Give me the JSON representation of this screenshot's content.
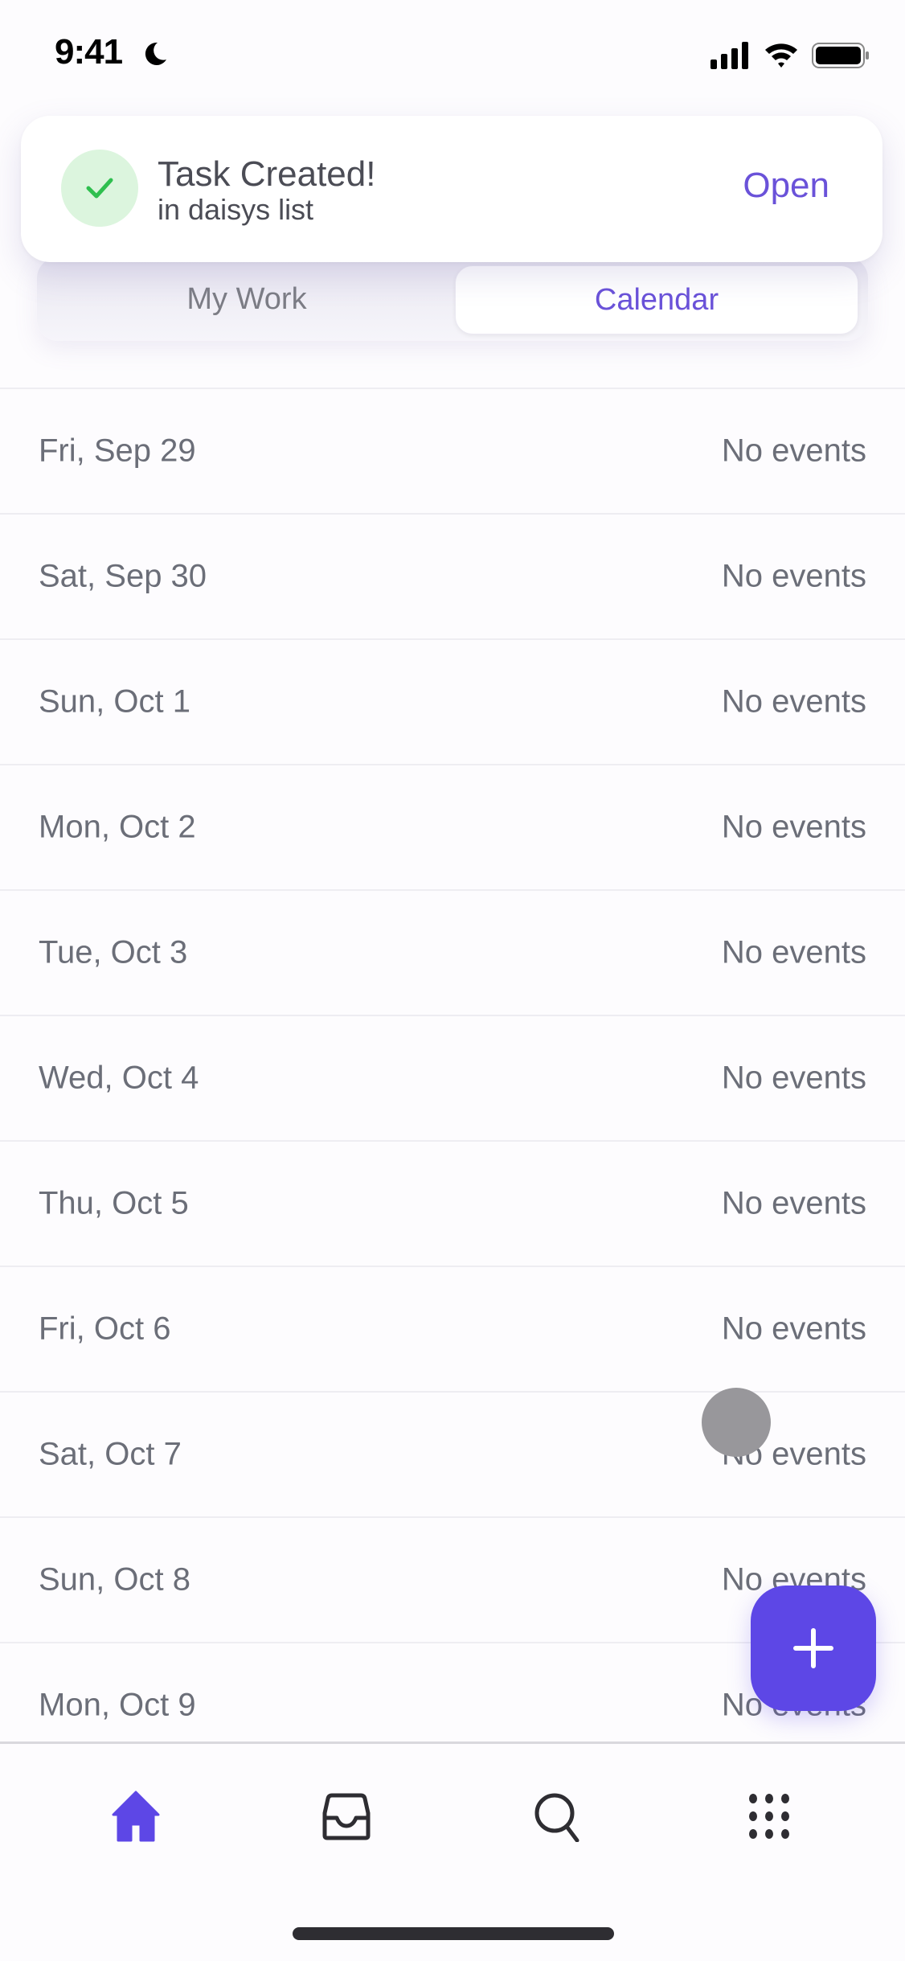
{
  "status_bar": {
    "time": "9:41",
    "focus_icon": "moon-icon",
    "signal_icon": "cellular-signal-icon",
    "wifi_icon": "wifi-icon",
    "battery_icon": "battery-icon"
  },
  "toast": {
    "icon": "checkmark-icon",
    "title": "Task Created!",
    "subtitle": "in daisys list",
    "action_label": "Open"
  },
  "segmented_control": {
    "tabs": [
      {
        "label": "My Work",
        "selected": false
      },
      {
        "label": "Calendar",
        "selected": true
      }
    ]
  },
  "calendar": {
    "days": [
      {
        "date": "Fri, Sep 29",
        "status": "No events"
      },
      {
        "date": "Sat, Sep 30",
        "status": "No events"
      },
      {
        "date": "Sun, Oct 1",
        "status": "No events"
      },
      {
        "date": "Mon, Oct 2",
        "status": "No events"
      },
      {
        "date": "Tue, Oct 3",
        "status": "No events"
      },
      {
        "date": "Wed, Oct 4",
        "status": "No events"
      },
      {
        "date": "Thu, Oct 5",
        "status": "No events"
      },
      {
        "date": "Fri, Oct 6",
        "status": "No events"
      },
      {
        "date": "Sat, Oct 7",
        "status": "No events"
      },
      {
        "date": "Sun, Oct 8",
        "status": "No events"
      },
      {
        "date": "Mon, Oct 9",
        "status": "No events"
      }
    ]
  },
  "fab": {
    "icon": "plus-icon"
  },
  "bottom_nav": {
    "items": [
      {
        "name": "home",
        "icon": "home-icon",
        "active": true
      },
      {
        "name": "inbox",
        "icon": "inbox-tray-icon",
        "active": false
      },
      {
        "name": "search",
        "icon": "search-icon",
        "active": false
      },
      {
        "name": "more",
        "icon": "grid-dots-icon",
        "active": false
      }
    ]
  },
  "colors": {
    "accent": "#6a52d9",
    "fab": "#5d47e6",
    "success_bg": "#dcf5de",
    "success": "#2fbf4f",
    "text_secondary": "#6b6e78"
  }
}
